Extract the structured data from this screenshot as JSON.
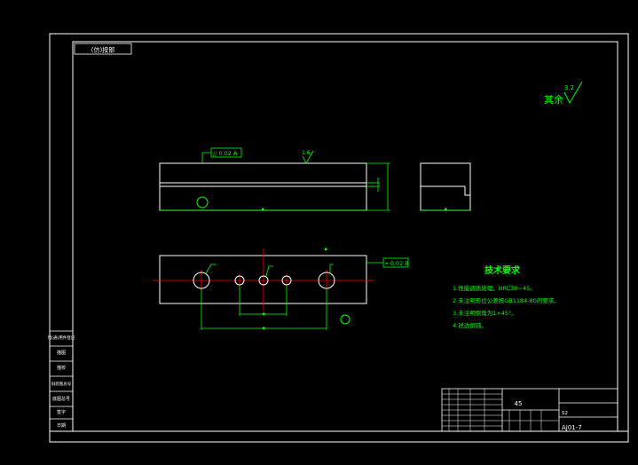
{
  "drawing": {
    "corner_tag": "(仿)按部",
    "surface_note": {
      "label": "其余",
      "value": "3.2"
    },
    "side_view": {
      "gdt_frame_text": "// 0.02 A",
      "roughness_value": "1.6"
    },
    "bottom_view": {
      "gdt_frame_text": "⌖ 0.02 B"
    },
    "tech_requirements": {
      "title": "技术要求",
      "items": [
        "1.性能调质处理，HRC30~45。",
        "2.未注明形位公差按GB1184-80的要求。",
        "3.未注明倒角为1×45°。",
        "4.锐边倒钝。"
      ]
    },
    "left_strip": [
      "借(通)用件登记",
      "描图",
      "描校",
      "旧底图总号",
      "底图总号",
      "签字",
      "日期"
    ],
    "title_block": {
      "material": "45",
      "drawing_number": "AJ01-7",
      "code": "S2"
    }
  },
  "colors": {
    "background": "#000000",
    "lines": "#ffffff",
    "dimension": "#00ff00",
    "center": "#ff0000",
    "annotation": "#00ff00",
    "point": "#00ff00"
  }
}
